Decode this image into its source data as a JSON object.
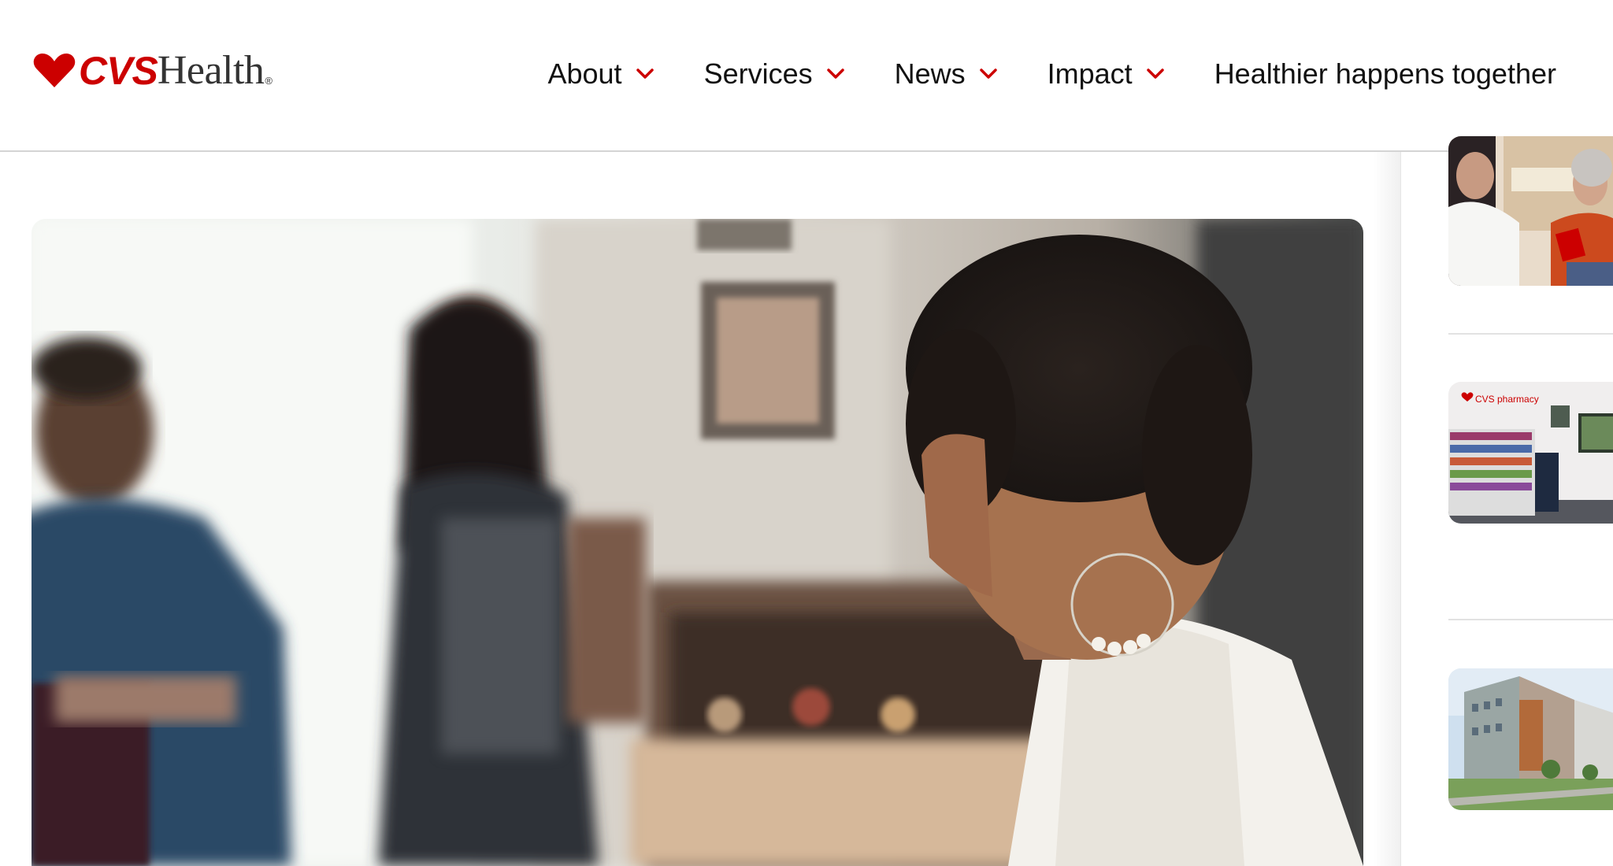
{
  "header": {
    "logo": {
      "brand": "CVS",
      "suffix": "Health",
      "registered": "®",
      "heart_color": "#cc0000",
      "brand_color": "#cc0000"
    },
    "nav": [
      {
        "label": "About",
        "has_dropdown": true
      },
      {
        "label": "Services",
        "has_dropdown": true
      },
      {
        "label": "News",
        "has_dropdown": true
      },
      {
        "label": "Impact",
        "has_dropdown": true
      },
      {
        "label": "Healthier happens together",
        "has_dropdown": false
      }
    ],
    "chevron_color": "#cc0000"
  },
  "hero": {
    "image": "family-at-kitchen-table-photo"
  },
  "sidebar": {
    "thumbnails": [
      {
        "image": "pharmacist-consulting-patient-photo"
      },
      {
        "image": "cvs-pharmacy-store-interior-photo",
        "sign_text": "CVS pharmacy"
      },
      {
        "image": "apartment-building-rendering-photo"
      }
    ]
  }
}
